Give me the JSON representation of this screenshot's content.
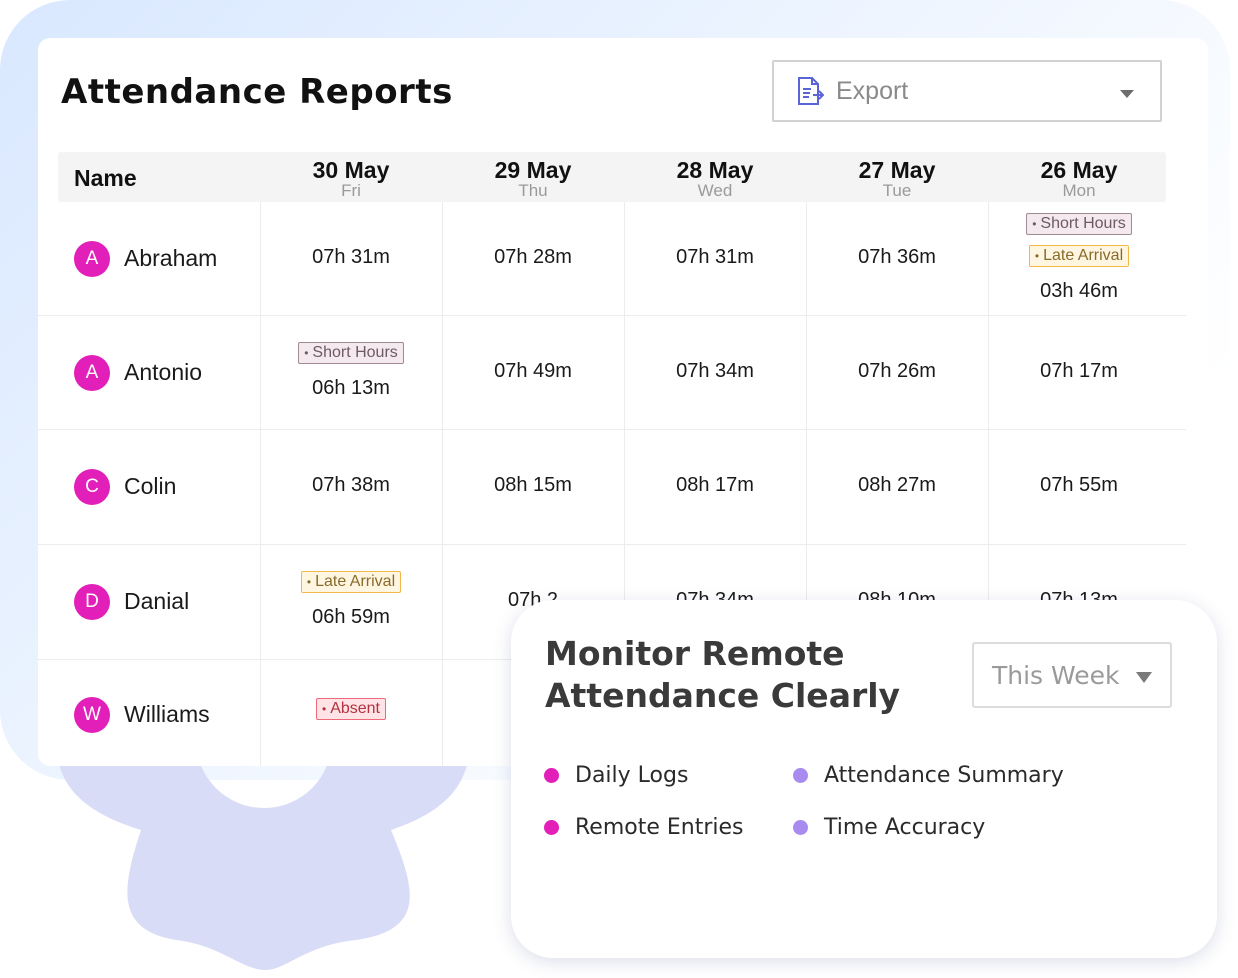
{
  "report": {
    "title": "Attendance Reports",
    "export_label": "Export",
    "name_header": "Name",
    "days": [
      {
        "date": "30 May",
        "weekday": "Fri"
      },
      {
        "date": "29 May",
        "weekday": "Thu"
      },
      {
        "date": "28 May",
        "weekday": "Wed"
      },
      {
        "date": "27 May",
        "weekday": "Tue"
      },
      {
        "date": "26 May",
        "weekday": "Mon"
      }
    ],
    "rows": [
      {
        "initial": "A",
        "name": "Abraham",
        "cells": [
          {
            "time": "07h 31m",
            "tags": []
          },
          {
            "time": "07h 28m",
            "tags": []
          },
          {
            "time": "07h 31m",
            "tags": []
          },
          {
            "time": "07h 36m",
            "tags": []
          },
          {
            "time": "03h 46m",
            "tags": [
              {
                "label": "Short Hours",
                "kind": "short"
              },
              {
                "label": "Late Arrival",
                "kind": "late"
              }
            ]
          }
        ]
      },
      {
        "initial": "A",
        "name": "Antonio",
        "cells": [
          {
            "time": "06h 13m",
            "tags": [
              {
                "label": "Short Hours",
                "kind": "short"
              }
            ]
          },
          {
            "time": "07h 49m",
            "tags": []
          },
          {
            "time": "07h 34m",
            "tags": []
          },
          {
            "time": "07h 26m",
            "tags": []
          },
          {
            "time": "07h 17m",
            "tags": []
          }
        ]
      },
      {
        "initial": "C",
        "name": "Colin",
        "cells": [
          {
            "time": "07h 38m",
            "tags": []
          },
          {
            "time": "08h 15m",
            "tags": []
          },
          {
            "time": "08h 17m",
            "tags": []
          },
          {
            "time": "08h 27m",
            "tags": []
          },
          {
            "time": "07h 55m",
            "tags": []
          }
        ]
      },
      {
        "initial": "D",
        "name": "Danial",
        "cells": [
          {
            "time": "06h 59m",
            "tags": [
              {
                "label": "Late Arrival",
                "kind": "late"
              }
            ]
          },
          {
            "time": "07h 2",
            "tags": []
          },
          {
            "time": "07h 34m",
            "tags": []
          },
          {
            "time": "08h 10m",
            "tags": []
          },
          {
            "time": "07h 13m",
            "tags": []
          }
        ]
      },
      {
        "initial": "W",
        "name": "Williams",
        "cells": [
          {
            "time": "",
            "tags": [
              {
                "label": "Absent",
                "kind": "absent"
              }
            ]
          },
          {
            "time": "",
            "tags": [
              {
                "label": "",
                "kind": "absent"
              }
            ]
          },
          {
            "time": "",
            "tags": []
          },
          {
            "time": "",
            "tags": []
          },
          {
            "time": "",
            "tags": []
          }
        ]
      }
    ]
  },
  "promo": {
    "title": "Monitor Remote Attendance Clearly",
    "period_select": "This Week",
    "features": [
      {
        "label": "Daily Logs",
        "color": "#e21fb9"
      },
      {
        "label": "Attendance Summary",
        "color": "#a98bf0"
      },
      {
        "label": "Remote Entries",
        "color": "#e21fb9"
      },
      {
        "label": "Time Accuracy",
        "color": "#a98bf0"
      }
    ]
  },
  "colors": {
    "avatar": "#e21fb9",
    "gear": "#d9dcf7",
    "export_icon": "#5a63d8"
  },
  "icons": {
    "export": "file-export-icon",
    "dropdown": "chevron-down-icon",
    "decoration": "gear-shape"
  }
}
